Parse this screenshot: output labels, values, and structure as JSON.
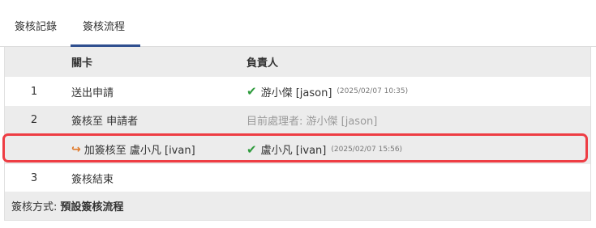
{
  "tabs": [
    {
      "label": "簽核記錄"
    },
    {
      "label": "簽核流程"
    }
  ],
  "table": {
    "headers": {
      "step": "關卡",
      "owner": "負責人"
    },
    "rows": [
      {
        "num": "1",
        "step": "送出申請",
        "owner": "游小傑 [jason]",
        "time": "(2025/02/07 10:35)"
      },
      {
        "num": "2",
        "step": "簽核至 申請者",
        "pending": "目前處理者: 游小傑 [jason]"
      },
      {
        "num": "",
        "step": "加簽核至 盧小凡 [ivan]",
        "owner": "盧小凡 [ivan]",
        "time": "(2025/02/07 15:56)"
      },
      {
        "num": "3",
        "step": "簽核結束"
      }
    ],
    "footer": {
      "label": "簽核方式:",
      "value": "預設簽核流程"
    }
  },
  "colors": {
    "accent": "#2f4f8f",
    "check": "#2e9b3c",
    "highlight": "#ee3d44",
    "arrow": "#e07a2b"
  }
}
